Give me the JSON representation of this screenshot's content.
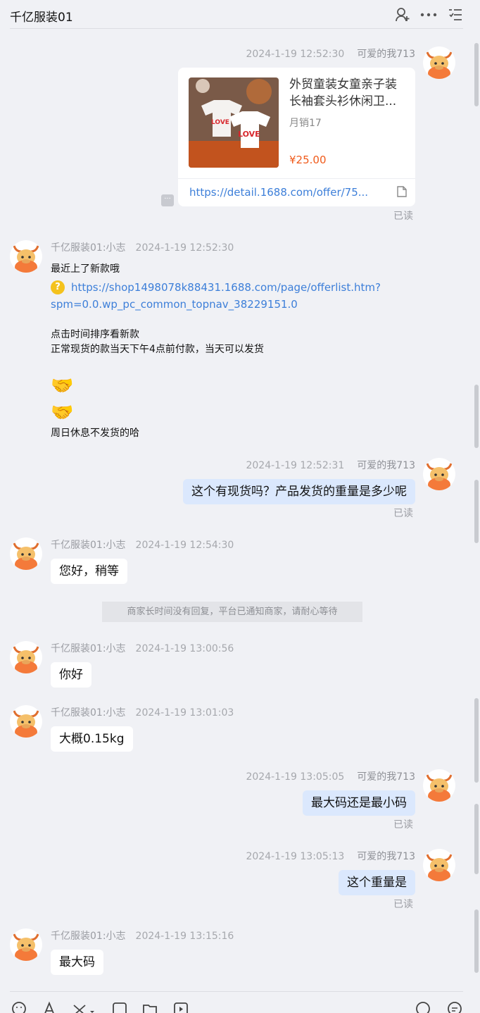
{
  "header": {
    "title": "千亿服装01",
    "icons": [
      "person-add-icon",
      "more-icon",
      "list-icon"
    ]
  },
  "product_card": {
    "time": "2024-1-19 12:52:30",
    "sender": "可爱的我713",
    "title": "外贸童装女童亲子装长袖套头衫休闲卫...",
    "sales": "月销17",
    "price": "¥25.00",
    "link": "https://detail.1688.com/offer/75...",
    "thumb_text": "LOVE",
    "read": "已读"
  },
  "shop_msg": {
    "sender": "千亿服装01:小志",
    "time": "2024-1-19 12:52:30",
    "line1": "最近上了新款哦",
    "link_line1": "https://shop1498078k88431.1688.com/page/offerlist.htm?",
    "link_line2": "spm=0.0.wp_pc_common_topnav_38229151.0",
    "line2": "点击时间排序看新款",
    "line3": "正常现货的款当天下午4点前付款，当天可以发货",
    "line4": "周日休息不发货的哈"
  },
  "msgs": [
    {
      "side": "out",
      "sender": "可爱的我713",
      "time": "2024-1-19 12:52:31",
      "text": "这个有现货吗？产品发货的重量是多少呢",
      "read": "已读"
    },
    {
      "side": "in",
      "sender": "千亿服装01:小志",
      "time": "2024-1-19 12:54:30",
      "text": "您好，稍等"
    },
    {
      "side": "in",
      "sender": "千亿服装01:小志",
      "time": "2024-1-19 13:00:56",
      "text": "你好"
    },
    {
      "side": "in",
      "sender": "千亿服装01:小志",
      "time": "2024-1-19 13:01:03",
      "text": "大概0.15kg"
    },
    {
      "side": "out",
      "sender": "可爱的我713",
      "time": "2024-1-19 13:05:05",
      "text": "最大码还是最小码",
      "read": "已读"
    },
    {
      "side": "out",
      "sender": "可爱的我713",
      "time": "2024-1-19 13:05:13",
      "text": "这个重量是",
      "read": "已读"
    },
    {
      "side": "in",
      "sender": "千亿服装01:小志",
      "time": "2024-1-19 13:15:16",
      "text": "最大码"
    }
  ],
  "system_notice": "商家长时间没有回复，平台已通知商家，请耐心等待",
  "toolbar": {
    "icons": [
      "emoji-icon",
      "font-icon",
      "scissors-icon",
      "image-icon",
      "folder-icon",
      "video-icon",
      "share-icon",
      "quick-reply-icon"
    ]
  },
  "colors": {
    "accent_link": "#3d7fd9",
    "price": "#f05a1a",
    "out_bubble": "#dbe8fd"
  }
}
